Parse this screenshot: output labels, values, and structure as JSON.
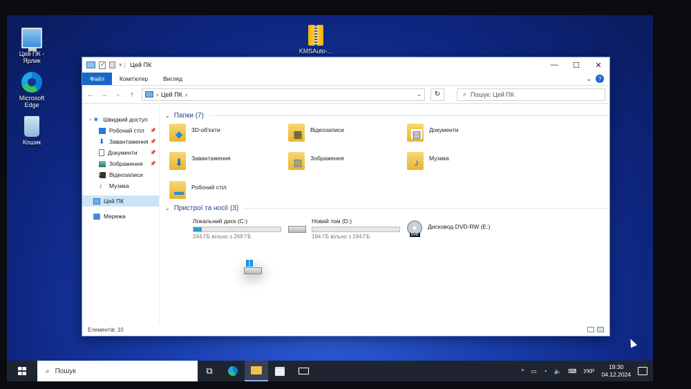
{
  "desktop": {
    "icons": [
      {
        "label": "Цей ПК - Ярлик"
      },
      {
        "label": "Microsoft Edge"
      },
      {
        "label": "Кошик"
      },
      {
        "label": "KMSAuto-..."
      }
    ]
  },
  "window": {
    "title": "Цей ПК",
    "controls": {
      "minimize": "—",
      "maximize": "☐",
      "close": "✕"
    },
    "ribbon": {
      "tabs": [
        {
          "label": "Файл"
        },
        {
          "label": "Комп'ютер"
        },
        {
          "label": "Вигляд"
        }
      ],
      "collapse": "⌄",
      "help": "?"
    },
    "nav": {
      "back": "←",
      "forward": "→",
      "recent": "⌄",
      "up": "↑",
      "address": "Цей ПК",
      "address_sep": "›",
      "address_dropdown": "⌄",
      "refresh": "↻",
      "search_icon": "⌕",
      "search_placeholder": "Пошук: Цей ПК"
    },
    "sidebar": {
      "items": [
        {
          "label": "Швидкий доступ",
          "pin": ""
        },
        {
          "label": "Робочий стіл",
          "pin": "📌"
        },
        {
          "label": "Завантаження",
          "pin": "📌"
        },
        {
          "label": "Документи",
          "pin": "📌"
        },
        {
          "label": "Зображення",
          "pin": "📌"
        },
        {
          "label": "Відеозаписи"
        },
        {
          "label": "Музика"
        },
        {
          "label": "Цей ПК"
        },
        {
          "label": "Мережа"
        }
      ]
    },
    "folders_header": "Папки (7)",
    "folders": [
      {
        "label": "3D-об'єкти",
        "overlay": "◆"
      },
      {
        "label": "Відеозаписи",
        "overlay": "▦"
      },
      {
        "label": "Документи",
        "overlay": "▤"
      },
      {
        "label": "Завантаження",
        "overlay": "⬇"
      },
      {
        "label": "Зображення",
        "overlay": "▨"
      },
      {
        "label": "Музика",
        "overlay": "♪"
      },
      {
        "label": "Робочий стіл",
        "overlay": "▬"
      }
    ],
    "devices_header": "Пристрої та носії (3)",
    "drives": [
      {
        "label": "Локальний диск (C:)",
        "free": "244 ГБ вільно з 269 ГБ",
        "used_fraction": 0.093
      },
      {
        "label": "Новий том (D:)",
        "free": "194 ГБ вільно з 194 ГБ",
        "used_fraction": 0.0
      },
      {
        "label": "Дисковод DVD-RW (E:)",
        "dvd_badge": "DVD"
      }
    ],
    "status": "Елементів: 10"
  },
  "taskbar": {
    "search_placeholder": "Пошук",
    "search_icon": "⌕",
    "taskview_icon": "⧉",
    "tray": {
      "chevron": "^",
      "lang": "УКР",
      "time": "19:30",
      "date": "04.12.2024"
    }
  },
  "colors": {
    "accent": "#1a66c9",
    "progress": "#26a0da",
    "folder_title": "#1e3f8a"
  }
}
